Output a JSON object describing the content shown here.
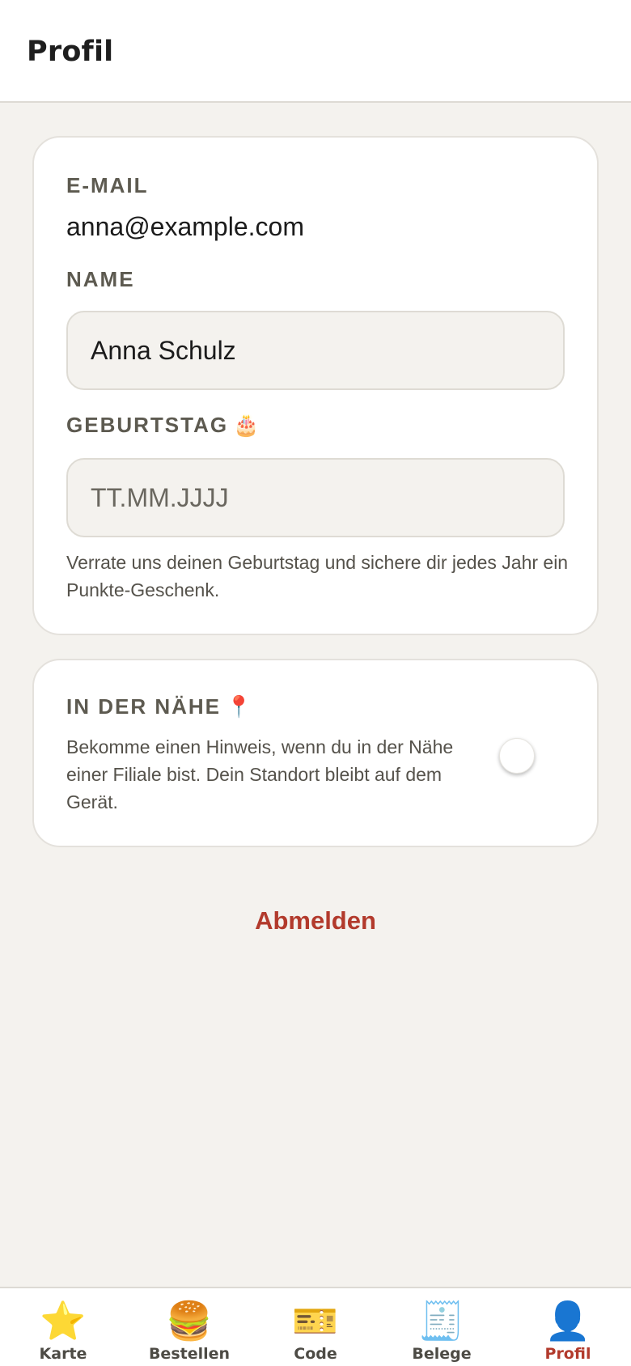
{
  "header": {
    "title": "Profil"
  },
  "profile": {
    "email_label": "E-MAIL",
    "email_value": "anna@example.com",
    "name_label": "NAME",
    "name_value": "Anna Schulz",
    "birthday_label": "GEBURTSTAG",
    "birthday_emoji": "🎂",
    "birthday_placeholder": "TT.MM.JJJJ",
    "birthday_help": "Verrate uns deinen Geburtstag und sichere dir jedes Jahr ein Punkte-Geschenk."
  },
  "nearby": {
    "label": "IN DER NÄHE",
    "emoji": "📍",
    "description": "Bekomme einen Hinweis, wenn du in der Nähe einer Filiale bist. Dein Standort bleibt auf dem Gerät.",
    "toggle_on": false
  },
  "logout_label": "Abmelden",
  "nav": {
    "items": [
      {
        "icon": "⭐",
        "icon_name": "star-icon",
        "label": "Karte",
        "active": false
      },
      {
        "icon": "🍔",
        "icon_name": "burger-icon",
        "label": "Bestellen",
        "active": false
      },
      {
        "icon": "🎫",
        "icon_name": "ticket-icon",
        "label": "Code",
        "active": false
      },
      {
        "icon": "🧾",
        "icon_name": "receipt-icon",
        "label": "Belege",
        "active": false
      },
      {
        "icon": "👤",
        "icon_name": "user-icon",
        "label": "Profil",
        "active": true
      }
    ],
    "active_color": "#b23a2c"
  }
}
